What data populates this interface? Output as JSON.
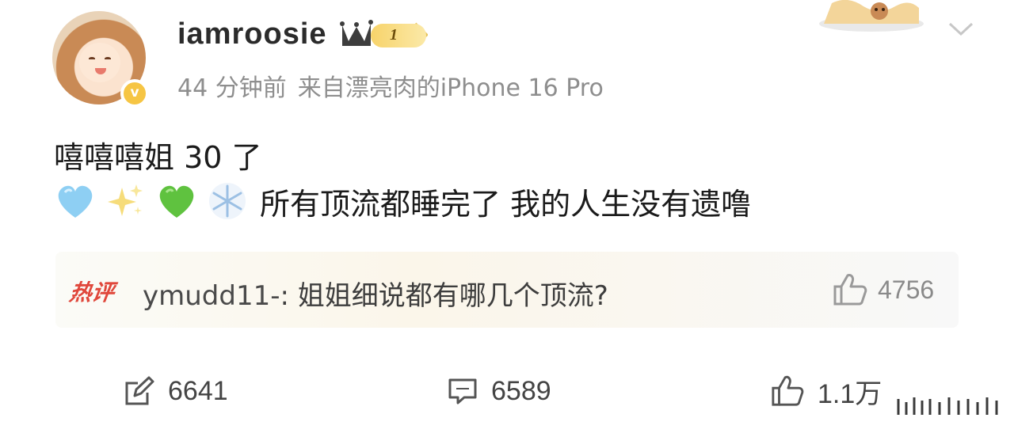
{
  "post": {
    "author": {
      "username": "iamroosie",
      "level_badge": "1",
      "verified_badge": "v",
      "avatar": "avatar-cartoon-girl"
    },
    "meta": {
      "time": "44 分钟前",
      "source": "来自漂亮肉的iPhone 16 Pro"
    },
    "content": {
      "line1": "嘻嘻嘻姐 30 了",
      "emojis": [
        "light-blue-heart",
        "sparkles",
        "green-heart",
        "snowflake"
      ],
      "line2_text": "所有顶流都睡完了 我的人生没有遗噜"
    },
    "hot_comment": {
      "tag": "热评",
      "user": "ymudd11-",
      "text": ": 姐姐细说都有哪几个顶流?",
      "likes": "4756"
    },
    "actions": {
      "repost_count": "6641",
      "comment_count": "6589",
      "like_count": "1.1万"
    }
  },
  "colors": {
    "hot_tag": "#e0473b",
    "meta_text": "#8e8e8e",
    "badge_gold": "#f6c544"
  },
  "icons": [
    "crown-icon",
    "chevron-down-icon",
    "thumbs-up-icon",
    "repost-icon",
    "comment-icon"
  ]
}
